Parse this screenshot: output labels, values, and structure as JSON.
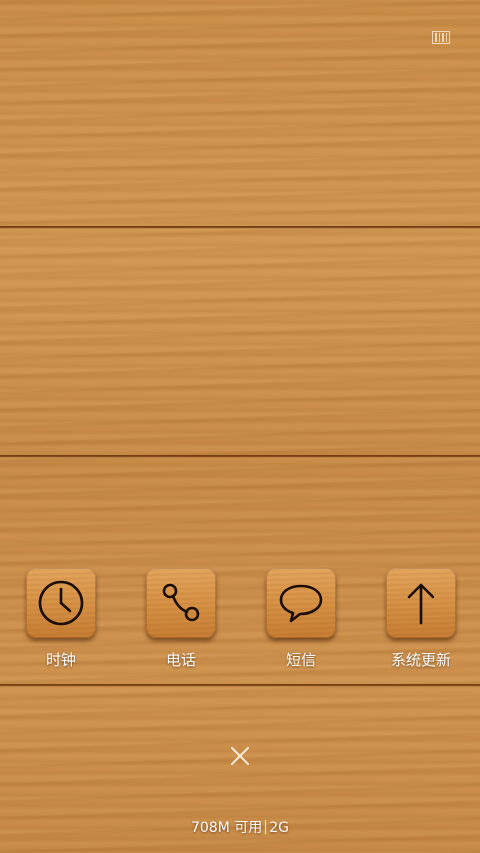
{
  "apps": [
    {
      "label": "时钟",
      "icon": "clock-icon"
    },
    {
      "label": "电话",
      "icon": "phone-icon"
    },
    {
      "label": "短信",
      "icon": "message-icon"
    },
    {
      "label": "系统更新",
      "icon": "arrow-up-icon"
    }
  ],
  "footer": {
    "memory": "708M 可用",
    "network": "2G"
  },
  "colors": {
    "wood": "#c98d47",
    "icon_stroke": "#1a0e04",
    "text": "#ffffff"
  }
}
